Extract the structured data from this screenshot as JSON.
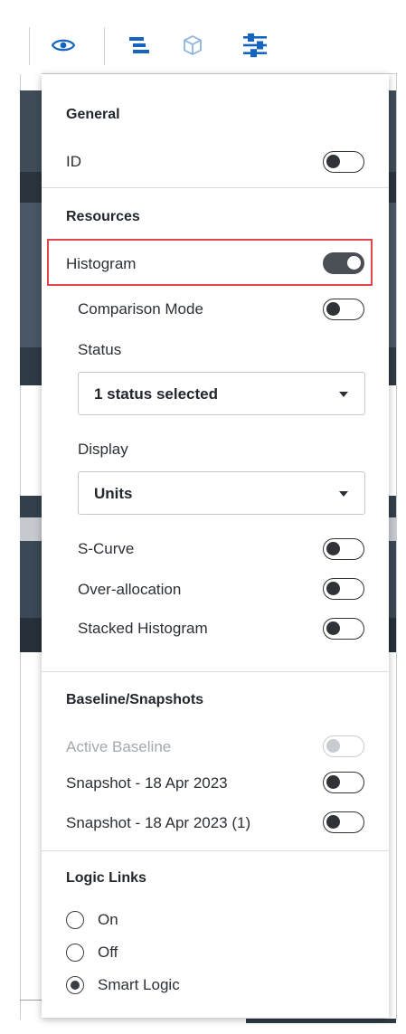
{
  "toolbar": {
    "icons": [
      "eye-icon",
      "gantt-bars-icon",
      "cube-icon",
      "sliders-icon"
    ],
    "active_color": "#1565c0"
  },
  "panel": {
    "general": {
      "title": "General",
      "id_label": "ID",
      "id_on": false
    },
    "resources": {
      "title": "Resources",
      "histogram_label": "Histogram",
      "histogram_on": true,
      "comparison_mode_label": "Comparison Mode",
      "comparison_mode_on": false,
      "status_label": "Status",
      "status_value": "1 status selected",
      "display_label": "Display",
      "display_value": "Units",
      "scurve_label": "S-Curve",
      "scurve_on": false,
      "overallocation_label": "Over-allocation",
      "overallocation_on": false,
      "stacked_histogram_label": "Stacked Histogram",
      "stacked_histogram_on": false
    },
    "baseline": {
      "title": "Baseline/Snapshots",
      "active_baseline_label": "Active Baseline",
      "active_baseline_disabled": true,
      "snapshot1_label": "Snapshot - 18 Apr 2023",
      "snapshot1_on": false,
      "snapshot2_label": "Snapshot - 18 Apr 2023 (1)",
      "snapshot2_on": false
    },
    "logic_links": {
      "title": "Logic Links",
      "options": [
        "On",
        "Off",
        "Smart Logic"
      ],
      "selected": "Smart Logic"
    }
  },
  "colors": {
    "highlight_border": "#e0474c",
    "background_dark": "#2f3e4b"
  }
}
